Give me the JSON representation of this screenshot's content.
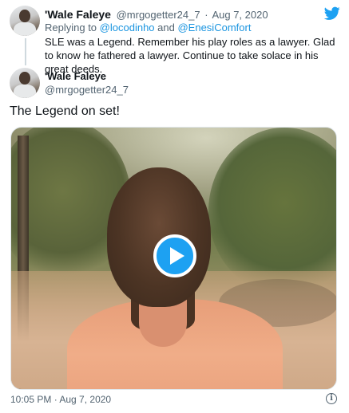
{
  "parent_tweet": {
    "display_name": "'Wale Faleye",
    "handle": "@mrgogetter24_7",
    "separator": "·",
    "date": "Aug 7, 2020",
    "replying_prefix": "Replying to",
    "reply_user_1": "@locodinho",
    "reply_and": "and",
    "reply_user_2": "@EnesiComfort",
    "text": "SLE was a Legend. Remember his play roles as a lawyer. Glad to know he fathered a lawyer. Continue to take solace in his great deeds."
  },
  "main_tweet": {
    "display_name": "'Wale Faleye",
    "handle": "@mrgogetter24_7",
    "text": "The Legend on set!",
    "timestamp": "10:05 PM · Aug 7, 2020"
  },
  "icons": {
    "brand": "twitter-bird-icon",
    "play": "play-icon",
    "info": "info-icon"
  },
  "colors": {
    "brand_blue": "#1da1f2",
    "link_blue": "#1b95e0",
    "muted_gray": "#536471"
  },
  "info_glyph": "i"
}
